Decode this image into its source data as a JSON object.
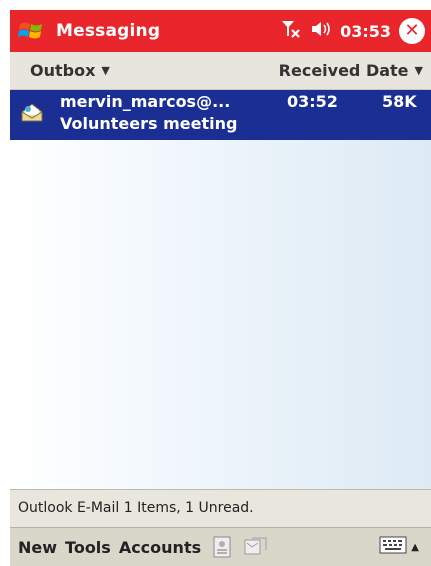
{
  "titlebar": {
    "app_title": "Messaging",
    "clock": "03:53",
    "close_glyph": "✕"
  },
  "header": {
    "folder_label": "Outbox",
    "sort_label": "Received Date",
    "caret": "▼"
  },
  "messages": [
    {
      "sender": "mervin_marcos@...",
      "time": "03:52",
      "size": "58K",
      "subject": "Volunteers meeting"
    }
  ],
  "status": {
    "text": "Outlook E-Mail  1 Items, 1 Unread."
  },
  "menubar": {
    "new_label": "New",
    "tools_label": "Tools",
    "accounts_label": "Accounts"
  },
  "icons": {
    "start": "windows-flag-icon",
    "signal": "antenna-no-signal-icon",
    "volume": "speaker-icon",
    "close": "close-icon",
    "message": "envelope-open-icon",
    "contacts": "contacts-card-icon",
    "send_receive": "send-receive-icon",
    "keyboard": "keyboard-icon"
  },
  "colors": {
    "titlebar": "#e8262b",
    "selected_row": "#1b2e93"
  }
}
